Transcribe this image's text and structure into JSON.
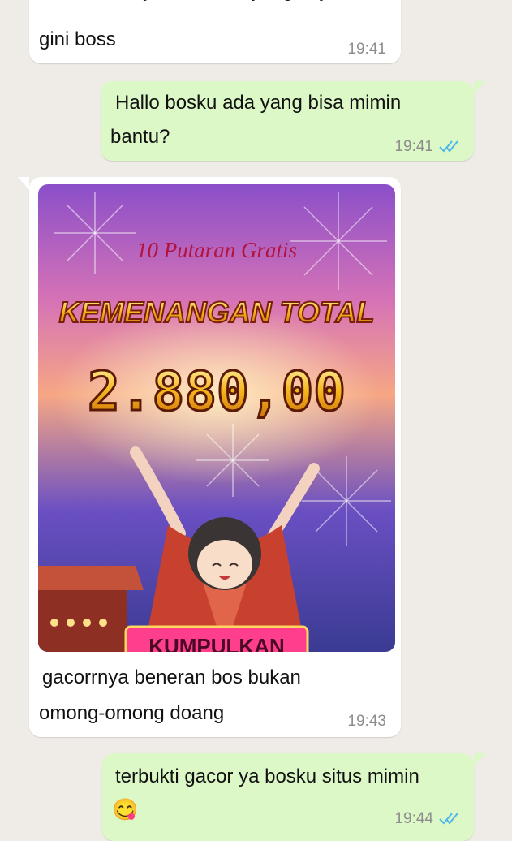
{
  "messages": [
    {
      "direction": "in",
      "text_line1": "dari dulu saya cari situs yang kaya",
      "text_line2": "gini boss",
      "time": "19:41"
    },
    {
      "direction": "out",
      "text_line1": "Hallo bosku ada yang bisa mimin",
      "text_line2": "bantu?",
      "time": "19:41",
      "status": "read"
    },
    {
      "direction": "in",
      "image": {
        "subtitle": "10 Putaran Gratis",
        "title": "KEMENANGAN TOTAL",
        "amount": "2.880,00",
        "button": "KUMPULKAN"
      },
      "text_line1": "gacorrnya beneran bos bukan",
      "text_line2": "omong-omong doang",
      "time": "19:43"
    },
    {
      "direction": "out",
      "text_line1": "terbukti gacor ya bosku situs mimin",
      "emoji": "😋",
      "time": "19:44",
      "status": "read"
    }
  ],
  "colors": {
    "background": "#efebe6",
    "incoming": "#ffffff",
    "outgoing": "#dcf8c6",
    "read_ticks": "#4fb6ec"
  },
  "icons": {
    "read_status": "double-check-icon"
  }
}
